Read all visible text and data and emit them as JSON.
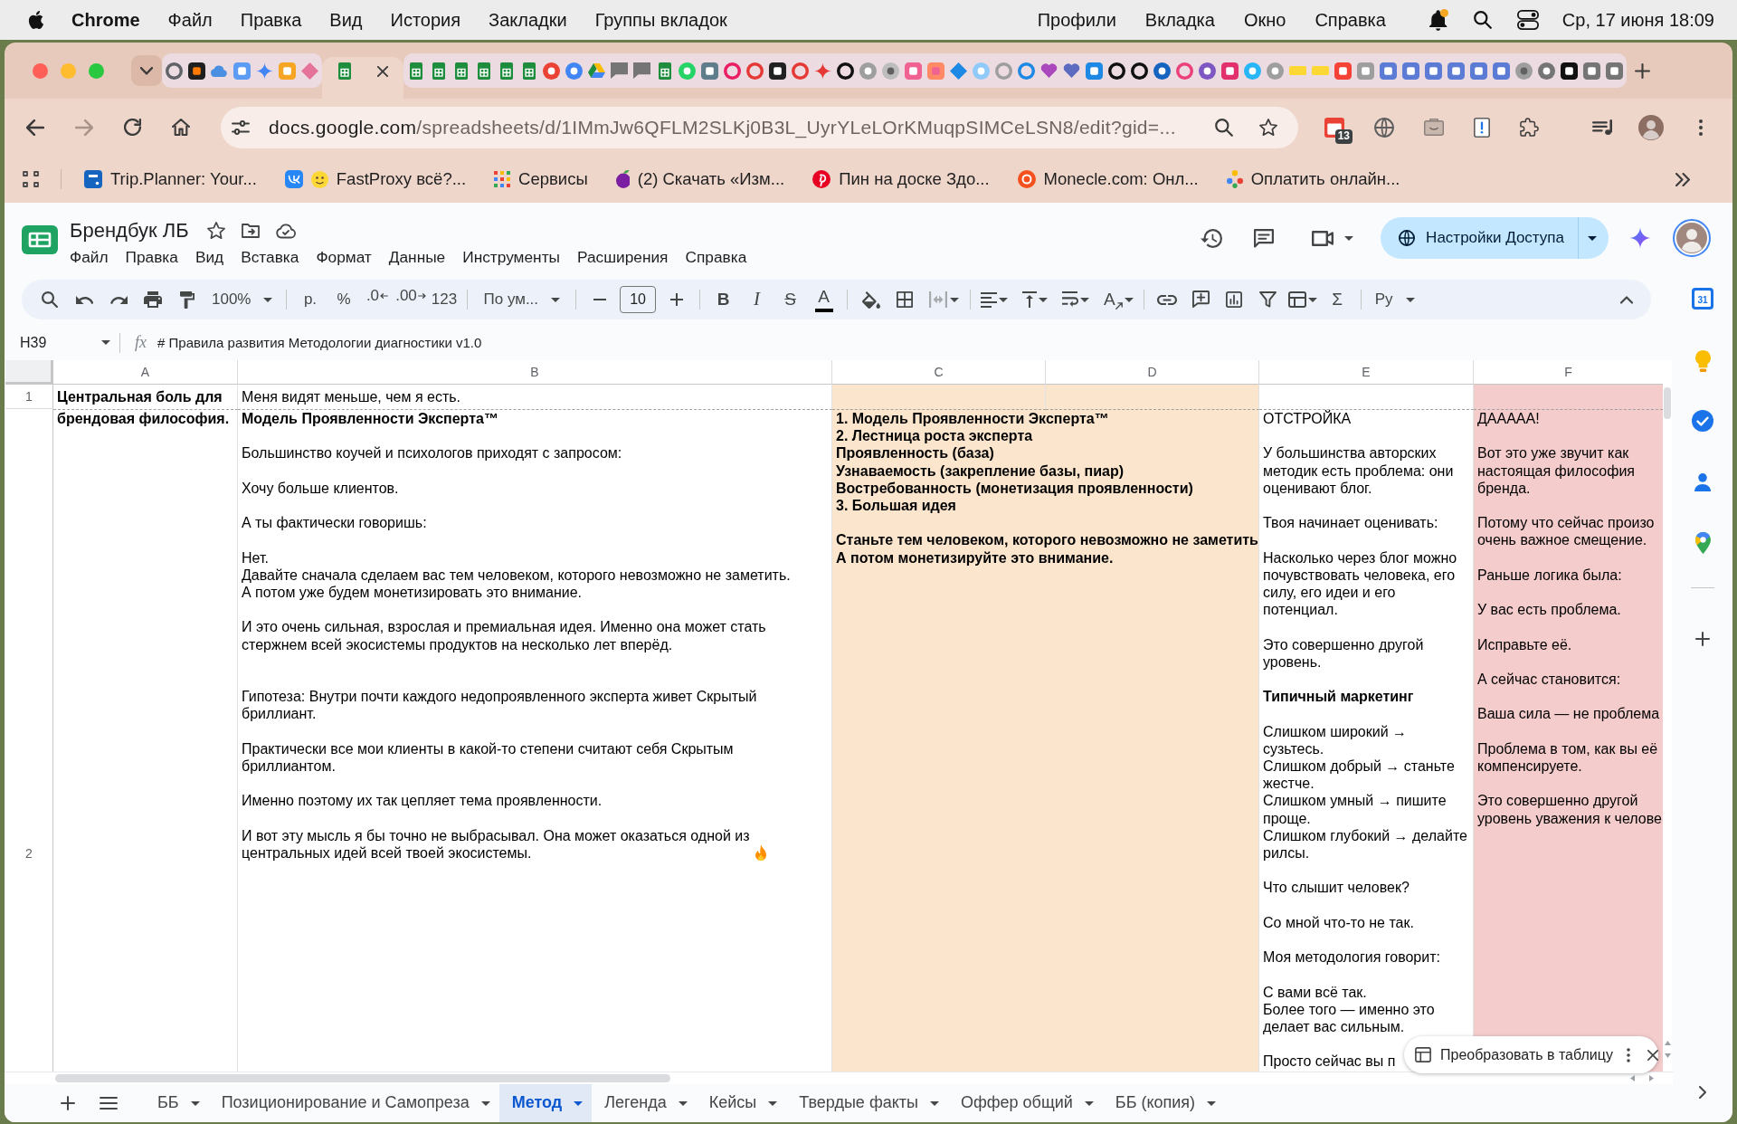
{
  "menu_bar": {
    "app_name": "Chrome",
    "menus": [
      "Файл",
      "Правка",
      "Вид",
      "История",
      "Закладки",
      "Группы вкладок"
    ],
    "status_menus": [
      "Профили",
      "Вкладка",
      "Окно",
      "Справка"
    ],
    "clock": "Ср, 17 июня 18:09"
  },
  "browser": {
    "tabs": [
      {
        "selected": false
      },
      {
        "selected": false
      },
      {
        "selected": false
      },
      {
        "selected": false
      },
      {
        "selected": false
      },
      {
        "selected": false
      },
      {
        "selected": false
      },
      {
        "selected": true
      },
      {
        "selected": false
      },
      {
        "selected": false
      },
      {
        "selected": false
      },
      {
        "selected": false
      },
      {
        "selected": false
      },
      {
        "selected": false
      },
      {
        "selected": false
      },
      {
        "selected": false
      },
      {
        "selected": false
      },
      {
        "selected": false
      },
      {
        "selected": false
      },
      {
        "selected": false
      },
      {
        "selected": false
      },
      {
        "selected": false
      },
      {
        "selected": false
      },
      {
        "selected": false
      },
      {
        "selected": false
      },
      {
        "selected": false
      },
      {
        "selected": false
      },
      {
        "selected": false
      },
      {
        "selected": false
      },
      {
        "selected": false
      },
      {
        "selected": false
      },
      {
        "selected": false
      },
      {
        "selected": false
      },
      {
        "selected": false
      },
      {
        "selected": false
      },
      {
        "selected": false
      },
      {
        "selected": false
      },
      {
        "selected": false
      },
      {
        "selected": false
      },
      {
        "selected": false
      },
      {
        "selected": false
      },
      {
        "selected": false
      },
      {
        "selected": false
      },
      {
        "selected": false
      },
      {
        "selected": false
      },
      {
        "selected": false
      },
      {
        "selected": false
      },
      {
        "selected": false
      },
      {
        "selected": false
      },
      {
        "selected": false
      },
      {
        "selected": false
      },
      {
        "selected": false
      },
      {
        "selected": false
      },
      {
        "selected": false
      },
      {
        "selected": false
      },
      {
        "selected": false
      },
      {
        "selected": false
      },
      {
        "selected": false
      },
      {
        "selected": false
      },
      {
        "selected": false
      },
      {
        "selected": false
      },
      {
        "selected": false
      }
    ],
    "address": {
      "domain": "docs.google.com",
      "path": "/spreadsheets/d/1IMmJw6QFLM2SLKj0B3L_UyrYLeLOrKMuqpSIMCeLSN8/edit?gid=..."
    },
    "extension_badge": "13",
    "bookmarks": [
      {
        "label": "Trip.Planner: Your..."
      },
      {
        "label": "FastProxy всё?..."
      },
      {
        "label": "Сервисы"
      },
      {
        "label": "(2) Скачать «Изм..."
      },
      {
        "label": "Пин на доске Здо..."
      },
      {
        "label": "Monecle.com: Онл..."
      },
      {
        "label": "Оплатить онлайн..."
      }
    ]
  },
  "document": {
    "title": "Брендбук ЛБ",
    "menus": [
      "Файл",
      "Правка",
      "Вид",
      "Вставка",
      "Формат",
      "Данные",
      "Инструменты",
      "Расширения",
      "Справка"
    ],
    "share_button": "Настройки Доступа"
  },
  "toolbar": {
    "zoom": "100%",
    "currency": "р.",
    "percent": "%",
    "decrease_decimals": ".0",
    "increase_decimals": ".00",
    "number_format": "123",
    "font": "По ум...",
    "font_size": "10",
    "bold": "B",
    "italic": "I",
    "strikethrough": "S",
    "text_color": "A",
    "text_rotation": "A",
    "functions": "Σ",
    "input_tools": "Ру"
  },
  "formula_bar": {
    "cell_reference": "H39",
    "fx": "fx",
    "formula": "# Правила развития Методологии диагностики v1.0"
  },
  "grid": {
    "columns": [
      "A",
      "B",
      "C",
      "D",
      "E",
      "F"
    ],
    "rows": [
      {
        "header": "1",
        "cells": [
          {
            "text": "Центральная боль для",
            "bold": true
          },
          {
            "text": "Меня видят меньше, чем я есть."
          },
          {
            "color": "#fce5cd"
          },
          {
            "color": "#fce5cd"
          },
          {},
          {
            "color": "#f4cccc"
          }
        ]
      },
      {
        "header": "2",
        "cells": [
          {
            "text": "брендовая философия.",
            "bold": true
          },
          {
            "text": "**Модель Проявленности Эксперта™**\n\nБольшинство коучей и психологов приходят с запросом:\n\nХочу больше клиентов.\n\nА ты фактически говоришь:\n\nНет.\nДавайте сначала сделаем вас тем человеком, которого невозможно не заметить.\nА потом уже будем монетизировать это внимание.\n\nИ это очень сильная, взрослая и премиальная идея. Именно она может стать\nстержнем всей экосистемы продуктов на несколько лет вперёд.\n\n\nГипотеза: Внутри почти каждого недопроявленного эксперта живет Скрытый\nбриллиант.\n\nПрактически все мои клиенты в какой-то степени считают себя Скрытым\nбриллиантом.\n\nИменно поэтому их так цепляет тема проявленности.\n\nИ вот эту мысль я бы точно не выбрасывал. Она может оказаться одной из\nцентральных идей всей твоей экосистемы.",
            "trailing_icon": true
          },
          {
            "text": "1. Модель Проявленности Эксперта™\n2. Лестница роста эксперта\nПроявленность (база)\nУзнаваемость (закрепление базы, пиар)\nВостребованность (монетизация проявленности)\n3. Большая идея\n\nСтаньте тем человеком, которого невозможно не заметить\nА потом монетизируйте это внимание.",
            "bold": true,
            "color": "#fce5cd",
            "merged": true
          },
          {
            "color": "#fce5cd"
          },
          {
            "text": "ОТСТРОЙКА\n\nУ большинства авторских\nметодик есть проблема: они\nоценивают блог.\n\nТвоя начинает оценивать:\n\nНасколько через блог можно\nпочувствовать человека, его\nсилу, его идеи и его\nпотенциал.\n\nЭто совершенно другой\nуровень.\n\n**Типичный маркетинг**\n\nСлишком широкий →\nсузьтесь.\nСлишком добрый → станьте\nжестче.\nСлишком умный → пишите\nпроще.\nСлишком глубокий → делайте\nрилсы.\n\nЧто слышит человек?\n\nСо мной что-то не так.\n\nМоя методология говорит:\n\nС вами всё так.\nБолее того — именно это\nделает вас сильным.\n\nПросто сейчас вы п"
          },
          {
            "text": "ДААААА!\n\nВот это уже звучит как\nнастоящая философия\nбренда.\n\nПотому что сейчас произо\nочень важное смещение.\n\nРаньше логика была:\n\nУ вас есть проблема.\n\nИсправьте её.\n\nА сейчас становится:\n\nВаша сила — не проблема\n\nПроблема в том, как вы её\nкомпенсируете.\n\nЭто совершенно другой\nуровень уважения к челове",
            "color": "#f4cccc"
          }
        ]
      }
    ]
  },
  "toast": {
    "label": "Преобразовать в таблицу"
  },
  "sheet_tabs": [
    {
      "label": "ББ",
      "selected": false
    },
    {
      "label": "Позиционирование и Самопреза",
      "selected": false
    },
    {
      "label": "Метод",
      "selected": true
    },
    {
      "label": "Легенда",
      "selected": false
    },
    {
      "label": "Кейсы",
      "selected": false
    },
    {
      "label": "Твердые факты",
      "selected": false
    },
    {
      "label": "Оффер общий",
      "selected": false
    },
    {
      "label": "ББ (копия)",
      "selected": false
    }
  ],
  "side_panel": {
    "calendar_day": "31"
  }
}
